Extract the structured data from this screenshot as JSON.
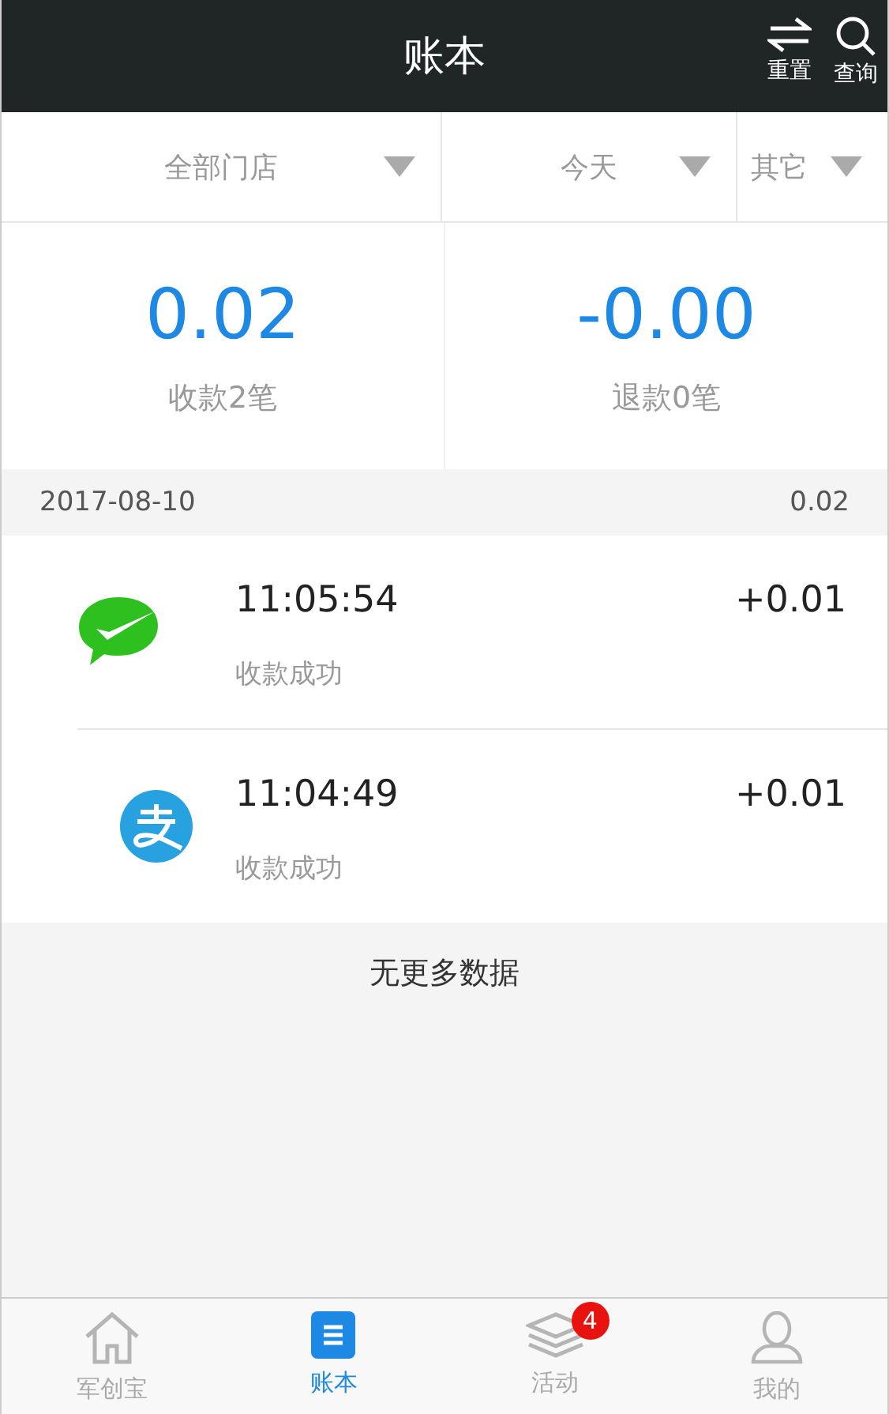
{
  "header": {
    "title": "账本",
    "actions": [
      {
        "kind": "reset",
        "label": "重置"
      },
      {
        "kind": "search",
        "label": "查询"
      }
    ]
  },
  "filters": [
    {
      "label": "全部门店"
    },
    {
      "label": "今天"
    },
    {
      "label": "其它"
    }
  ],
  "summary": [
    {
      "amount": "0.02",
      "caption": "收款2笔"
    },
    {
      "amount": "-0.00",
      "caption": "退款0笔"
    }
  ],
  "group": {
    "date": "2017-08-10",
    "total": "0.02"
  },
  "transactions": [
    {
      "kind": "wechat",
      "time": "11:05:54",
      "status": "收款成功",
      "amount": "+0.01"
    },
    {
      "kind": "alipay",
      "time": "11:04:49",
      "status": "收款成功",
      "amount": "+0.01"
    }
  ],
  "end_note": "无更多数据",
  "tabs": [
    {
      "kind": "home",
      "label": "军创宝",
      "selected": false
    },
    {
      "kind": "ledger",
      "label": "账本",
      "selected": true
    },
    {
      "kind": "activity",
      "label": "活动",
      "selected": false,
      "badge": "4"
    },
    {
      "kind": "profile",
      "label": "我的",
      "selected": false
    }
  ]
}
